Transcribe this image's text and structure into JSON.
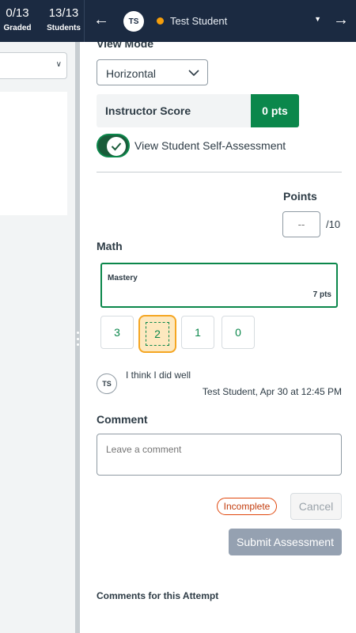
{
  "topbar": {
    "graded_count": "0/13",
    "graded_label": "Graded",
    "students_count": "13/13",
    "students_label": "Students",
    "prev_icon": "arrow-left",
    "next_icon": "arrow-right",
    "avatar_initials": "TS",
    "student_name": "Test Student",
    "status_color": "#f59e0b"
  },
  "assessment": {
    "view_mode_label": "View Mode",
    "view_mode_value": "Horizontal",
    "instructor_score_label": "Instructor Score",
    "instructor_score_value": "0 pts",
    "self_assessment_toggle_label": "View Student Self-Assessment",
    "self_assessment_toggle_on": true,
    "points_label": "Points",
    "points_placeholder": "--",
    "points_max": "/10",
    "criterion": {
      "name": "Math",
      "selected_rating_title": "Mastery",
      "selected_rating_points": "7 pts",
      "ratings": [
        "3",
        "2",
        "1",
        "0"
      ],
      "highlighted_rating": "2"
    },
    "self_assessment": {
      "avatar_initials": "TS",
      "comment": "I think I did well",
      "meta": "Test Student, Apr 30 at 12:45 PM"
    },
    "comment_label": "Comment",
    "comment_placeholder": "Leave a comment",
    "status_badge": "Incomplete",
    "cancel_label": "Cancel",
    "submit_label": "Submit Assessment",
    "comments_for_attempt_label": "Comments for this Attempt"
  },
  "colors": {
    "topbar_bg": "#1b2a41",
    "success_green": "#0b874b",
    "warning_orange": "#f5a623",
    "danger_red": "#e0480e",
    "submit_disabled": "#95a1b1"
  }
}
